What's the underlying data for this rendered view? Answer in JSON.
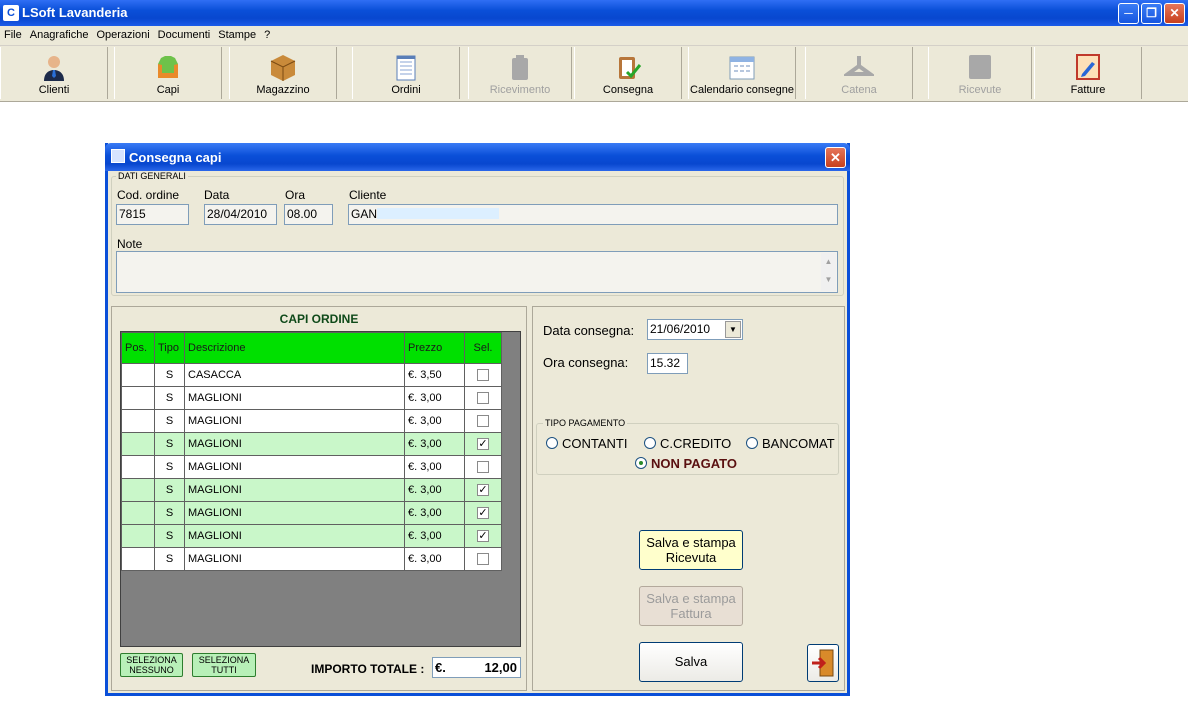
{
  "window": {
    "title": "LSoft Lavanderia",
    "icon_letter": "C"
  },
  "menu": [
    "File",
    "Anagrafiche",
    "Operazioni",
    "Documenti",
    "Stampe",
    "?"
  ],
  "toolbar": [
    {
      "label": "Clienti",
      "enabled": true
    },
    {
      "label": "Capi",
      "enabled": true
    },
    {
      "label": "Magazzino",
      "enabled": true
    },
    {
      "label": "Ordini",
      "enabled": true
    },
    {
      "label": "Ricevimento",
      "enabled": false
    },
    {
      "label": "Consegna",
      "enabled": true
    },
    {
      "label": "Calendario consegne",
      "enabled": true
    },
    {
      "label": "Catena",
      "enabled": false
    },
    {
      "label": "Ricevute",
      "enabled": false
    },
    {
      "label": "Fatture",
      "enabled": true
    }
  ],
  "dialog": {
    "title": "Consegna capi",
    "general": {
      "legend": "DATI GENERALI",
      "cod_label": "Cod. ordine",
      "cod_value": "7815",
      "data_label": "Data",
      "data_value": "28/04/2010",
      "ora_label": "Ora",
      "ora_value": "08.00",
      "cliente_label": "Cliente",
      "cliente_value": "GAN",
      "note_label": "Note",
      "note_value": ""
    },
    "capi": {
      "title": "CAPI ORDINE",
      "columns": [
        "Pos.",
        "Tipo",
        "Descrizione",
        "Prezzo",
        "Sel."
      ],
      "rows": [
        {
          "pos": "",
          "tipo": "S",
          "descr": "CASACCA",
          "prezzo": "€. 3,50",
          "sel": false
        },
        {
          "pos": "",
          "tipo": "S",
          "descr": "MAGLIONI",
          "prezzo": "€. 3,00",
          "sel": false
        },
        {
          "pos": "",
          "tipo": "S",
          "descr": "MAGLIONI",
          "prezzo": "€. 3,00",
          "sel": false
        },
        {
          "pos": "",
          "tipo": "S",
          "descr": "MAGLIONI",
          "prezzo": "€. 3,00",
          "sel": true
        },
        {
          "pos": "",
          "tipo": "S",
          "descr": "MAGLIONI",
          "prezzo": "€. 3,00",
          "sel": false
        },
        {
          "pos": "",
          "tipo": "S",
          "descr": "MAGLIONI",
          "prezzo": "€. 3,00",
          "sel": true
        },
        {
          "pos": "",
          "tipo": "S",
          "descr": "MAGLIONI",
          "prezzo": "€. 3,00",
          "sel": true
        },
        {
          "pos": "",
          "tipo": "S",
          "descr": "MAGLIONI",
          "prezzo": "€. 3,00",
          "sel": true
        },
        {
          "pos": "",
          "tipo": "S",
          "descr": "MAGLIONI",
          "prezzo": "€. 3,00",
          "sel": false
        }
      ],
      "btn_none_1": "SELEZIONA",
      "btn_none_2": "NESSUNO",
      "btn_all_1": "SELEZIONA",
      "btn_all_2": "TUTTI",
      "total_label": "IMPORTO TOTALE :",
      "total_currency": "€.",
      "total_value": "12,00"
    },
    "consegna": {
      "data_label": "Data consegna:",
      "data_value": "21/06/2010",
      "ora_label": "Ora consegna:",
      "ora_value": "15.32"
    },
    "pagamento": {
      "legend": "TIPO PAGAMENTO",
      "options": [
        "CONTANTI",
        "C.CREDITO",
        "BANCOMAT",
        "NON PAGATO"
      ],
      "selected": "NON PAGATO"
    },
    "buttons": {
      "ricevuta_1": "Salva e stampa",
      "ricevuta_2": "Ricevuta",
      "fattura_1": "Salva e stampa",
      "fattura_2": "Fattura",
      "salva": "Salva"
    }
  }
}
